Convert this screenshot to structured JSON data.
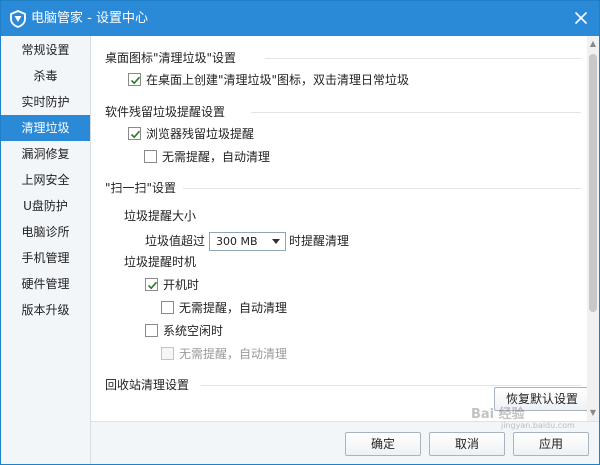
{
  "window": {
    "title": "电脑管家 - 设置中心",
    "accent_color": "#2b8ad7",
    "logo_icon": "shield-logo-icon",
    "close_icon": "close-icon"
  },
  "sidebar": {
    "items": [
      {
        "label": "常规设置",
        "active": false
      },
      {
        "label": "杀毒",
        "active": false
      },
      {
        "label": "实时防护",
        "active": false
      },
      {
        "label": "清理垃圾",
        "active": true
      },
      {
        "label": "漏洞修复",
        "active": false
      },
      {
        "label": "上网安全",
        "active": false
      },
      {
        "label": "U盘防护",
        "active": false
      },
      {
        "label": "电脑诊所",
        "active": false
      },
      {
        "label": "手机管理",
        "active": false
      },
      {
        "label": "硬件管理",
        "active": false
      },
      {
        "label": "版本升级",
        "active": false
      }
    ]
  },
  "content": {
    "desktop_icon": {
      "title": "桌面图标\"清理垃圾\"设置",
      "create_icon": {
        "label": "在桌面上创建\"清理垃圾\"图标，双击清理日常垃圾",
        "checked": true
      }
    },
    "residual": {
      "title": "软件残留垃圾提醒设置",
      "browser_reminder": {
        "label": "浏览器残留垃圾提醒",
        "checked": true
      },
      "auto_clean": {
        "label": "无需提醒，自动清理",
        "checked": false
      }
    },
    "scan": {
      "title": "\"扫一扫\"设置",
      "size_heading": "垃圾提醒大小",
      "size_prefix": "垃圾值超过",
      "size_value": "300 MB",
      "size_suffix": "时提醒清理",
      "timing_heading": "垃圾提醒时机",
      "on_boot": {
        "label": "开机时",
        "checked": true
      },
      "on_boot_auto": {
        "label": "无需提醒，自动清理",
        "checked": false
      },
      "on_idle": {
        "label": "系统空闲时",
        "checked": false
      },
      "on_idle_auto": {
        "label": "无需提醒，自动清理",
        "checked": false,
        "disabled": true
      }
    },
    "recycle": {
      "title": "回收站清理设置"
    },
    "restore_button": "恢复默认设置"
  },
  "footer": {
    "ok": "确定",
    "cancel": "取消",
    "apply": "应用"
  },
  "watermark": {
    "main": "Bai 经验",
    "sub": "jingyan.baidu.com"
  }
}
